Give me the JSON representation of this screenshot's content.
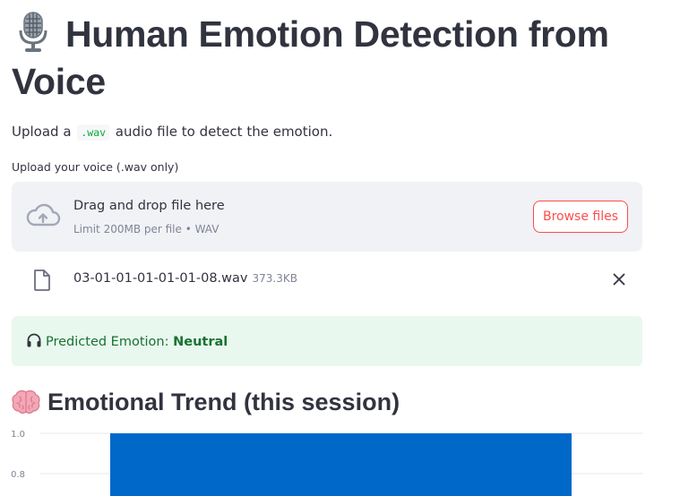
{
  "header": {
    "title": "Human Emotion Detection from Voice",
    "title_icon": "microphone-icon"
  },
  "intro": {
    "prefix": "Upload a",
    "code": ".wav",
    "suffix": "audio file to detect the emotion."
  },
  "uploader": {
    "label": "Upload your voice (.wav only)",
    "drop_title": "Drag and drop file here",
    "drop_limit": "Limit 200MB per file • WAV",
    "browse_label": "Browse files",
    "upload_icon": "cloud-upload-icon"
  },
  "file": {
    "name": "03-01-01-01-01-01-08.wav",
    "size": "373.3KB",
    "icon": "file-icon"
  },
  "result": {
    "label": "Predicted Emotion:",
    "value": "Neutral",
    "icon": "headphones-icon",
    "bg_color": "#e9f8ee",
    "text_color": "#177233"
  },
  "trend": {
    "title": "Emotional Trend (this session)",
    "icon": "brain-icon"
  },
  "chart_data": {
    "type": "bar",
    "ylabel": "",
    "xlabel": "",
    "y_ticks": [
      "1.0",
      "0.8"
    ],
    "y_tick_values": [
      1.0,
      0.8
    ],
    "ylim_visible": [
      0.75,
      1.0
    ],
    "grid": true,
    "series": [
      {
        "values": [
          1.0
        ],
        "color": "#0068c9"
      }
    ]
  },
  "theme": {
    "accent": "#ff4b4b",
    "text": "#31333f",
    "muted": "#808495",
    "dropzone_bg": "#f0f2f6",
    "bar_color": "#0068c9"
  }
}
